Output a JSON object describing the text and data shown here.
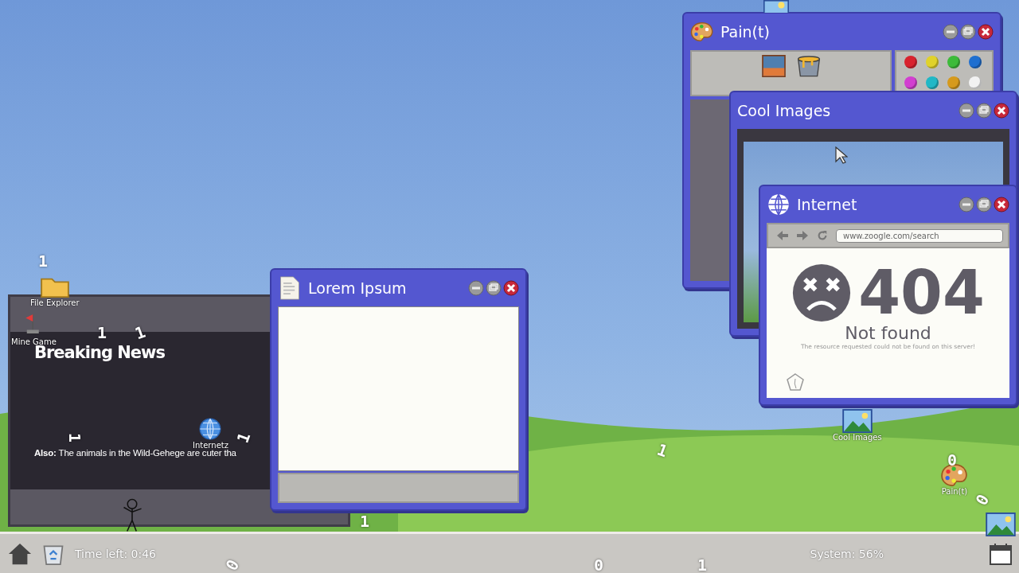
{
  "windows": [
    {
      "kind": "news",
      "headline": "Breaking News",
      "ticker": "**Also:** The animals in the Wild-Gehege are cuter tha"
    },
    {
      "kind": "paint",
      "title": "Pain(t)",
      "swatches": [
        {
          "color": "#d8232e"
        },
        {
          "color": "#e0d22a"
        },
        {
          "color": "#3dbb3a"
        },
        {
          "color": "#1f6fd0"
        },
        {
          "color": "#d23fd0"
        },
        {
          "color": "#21b8c6"
        },
        {
          "color": "#d69a1c"
        },
        {
          "color": "#f2f2f2"
        }
      ]
    },
    {
      "kind": "images",
      "title": "Cool Images"
    },
    {
      "kind": "browser",
      "title": "Internet",
      "url": "www.zoogle.com/search",
      "error_code": "404",
      "error_title": "Not found",
      "error_message": "The resource requested could not be found on this server!"
    },
    {
      "kind": "editor",
      "title": "Lorem Ipsum"
    }
  ],
  "desktop_icons": [
    {
      "kind": "folder",
      "label": "File Explorer"
    },
    {
      "kind": "flag",
      "label": "Mine Game"
    },
    {
      "kind": "globe",
      "label": "Internetz"
    },
    {
      "kind": "image",
      "label": "Cool Images"
    },
    {
      "kind": "palette",
      "label": "Pain(t)"
    }
  ],
  "taskbar": {
    "timer": "Time left: 0:46",
    "system": "System: 56%"
  },
  "particles": [
    "1",
    "1",
    "1",
    "1",
    "1",
    "1",
    "0",
    "0",
    "1",
    "0",
    "0",
    "1"
  ]
}
